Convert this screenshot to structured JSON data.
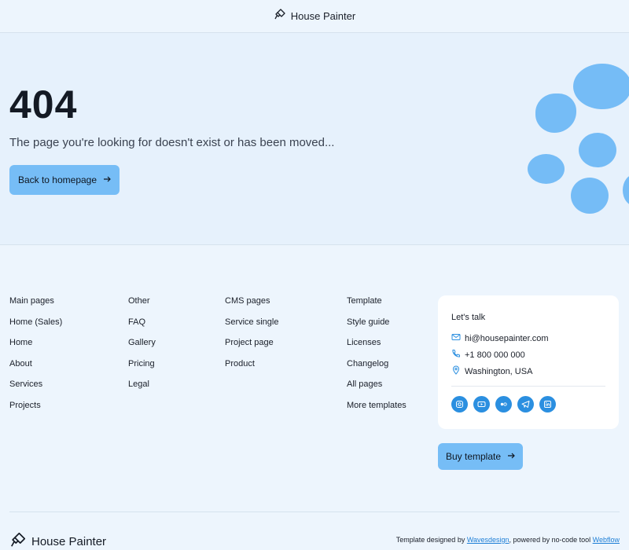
{
  "header": {
    "brand": "House Painter"
  },
  "hero": {
    "code": "404",
    "message": "The page you're looking for doesn't exist or has been moved...",
    "back_button": "Back to homepage"
  },
  "footer": {
    "columns": [
      {
        "items": [
          "Main pages",
          "Home (Sales)",
          "Home",
          "About",
          "Services",
          "Projects"
        ]
      },
      {
        "items": [
          "Other",
          "FAQ",
          "Gallery",
          "Pricing",
          "Legal"
        ]
      },
      {
        "items": [
          "CMS pages",
          "Service single",
          "Project page",
          "Product"
        ]
      },
      {
        "items": [
          "Template",
          "Style guide",
          "Licenses",
          "Changelog",
          "All pages",
          "More templates"
        ]
      }
    ],
    "contact": {
      "title": "Let's talk",
      "email": "hi@housepainter.com",
      "phone": "+1 800 000 000",
      "location": "Washington, USA",
      "socials": [
        "instagram-icon",
        "youtube-icon",
        "flickr-icon",
        "telegram-icon",
        "linkedin-icon"
      ]
    },
    "buy_button": "Buy template",
    "bottom_brand": "House Painter",
    "credits": {
      "prefix": "Template designed by",
      "designer": "Wavesdesign",
      "middle": ", powered by no-code tool",
      "tool": "Webflow"
    }
  },
  "colors": {
    "accent": "#76bdf6",
    "blob": "#75bcf6",
    "background": "#edf5fd",
    "link": "#1e7fd6"
  }
}
